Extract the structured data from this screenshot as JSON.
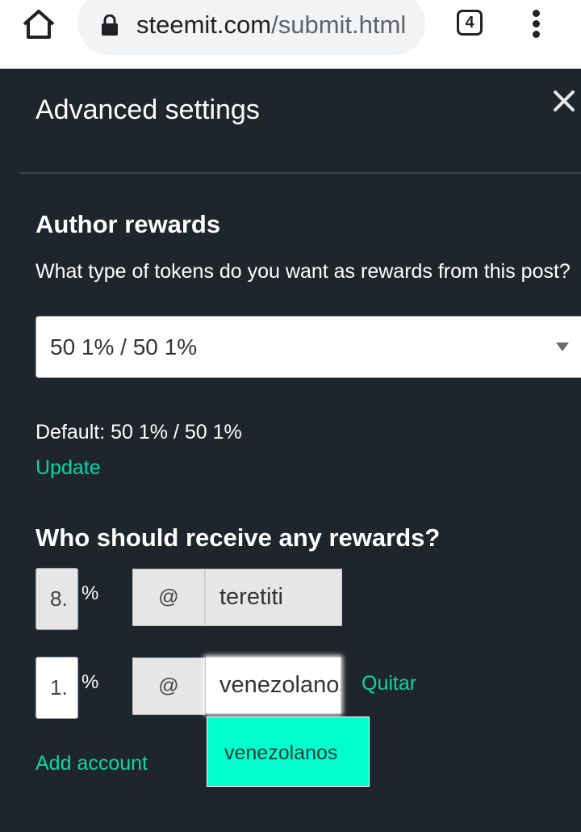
{
  "browser": {
    "url_domain": "steemit.com",
    "url_path": "/submit.html",
    "tab_count": "4",
    "icons": [
      "home-icon",
      "lock-icon",
      "tabs-icon",
      "more-vert-icon"
    ]
  },
  "dialog": {
    "title": "Advanced settings",
    "close_icon": "close-icon"
  },
  "author_rewards": {
    "heading": "Author rewards",
    "question": "What type of tokens do you want as rewards from this post?",
    "selected": "50 1% / 50 1%",
    "default_text": "Default: 50 1% / 50 1%",
    "update_label": "Update"
  },
  "beneficiaries": {
    "heading": "Who should receive any rewards?",
    "rows": [
      {
        "percent": "8.",
        "percent_sign": "%",
        "at": "@",
        "account": "teretiti",
        "editable": false
      },
      {
        "percent": "1.",
        "percent_sign": "%",
        "at": "@",
        "account": "venezolanos",
        "editable": true,
        "remove_label": "Quitar"
      }
    ],
    "suggestion": "venezolanos",
    "add_label": "Add account"
  },
  "colors": {
    "background": "#1f252c",
    "accent": "#06d6a9",
    "suggestion_bg": "#00ffcc"
  }
}
